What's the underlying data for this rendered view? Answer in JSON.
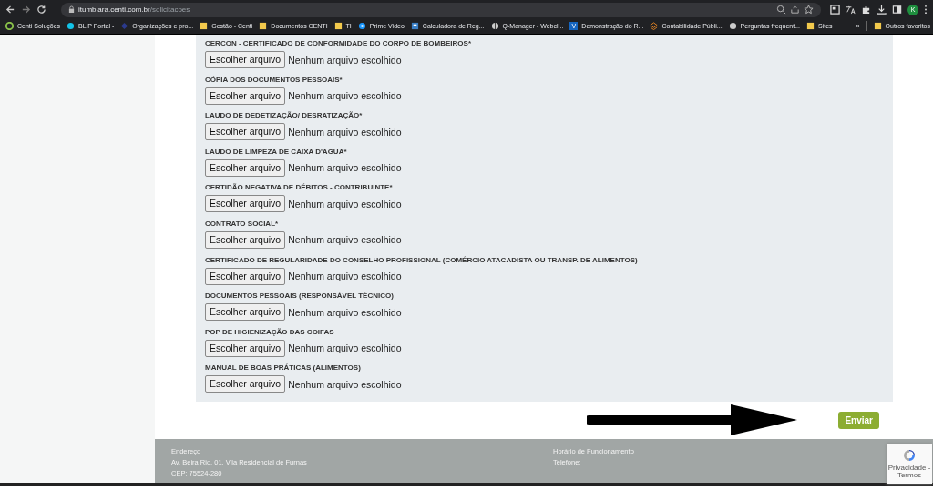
{
  "browser": {
    "url_host": "itumbiara.centi.com.br",
    "url_path": "/solicitacoes",
    "profile_initial": "K",
    "bookmarks": [
      {
        "label": "Centi Soluções",
        "kind": "logo"
      },
      {
        "label": "BLiP Portal -",
        "kind": "drop"
      },
      {
        "label": "Organizações e pro...",
        "kind": "diamond"
      },
      {
        "label": "Gestão - Centi",
        "kind": "folder"
      },
      {
        "label": "Documentos CENTI",
        "kind": "folder"
      },
      {
        "label": "TI",
        "kind": "folder"
      },
      {
        "label": "Prime Video",
        "kind": "circle"
      },
      {
        "label": "Calculadora de Reg...",
        "kind": "square"
      },
      {
        "label": "Q-Manager - Webcl...",
        "kind": "globe"
      },
      {
        "label": "Demonstração do R...",
        "kind": "letter",
        "glyph": "V"
      },
      {
        "label": "Contabilidade Públi...",
        "kind": "layers"
      },
      {
        "label": "Perguntas frequent...",
        "kind": "globe"
      },
      {
        "label": "Sites",
        "kind": "folder"
      }
    ],
    "overflow": "»",
    "other_bookmarks": "Outros favoritos"
  },
  "form": {
    "fields": [
      {
        "label": "CERCON - CERTIFICADO DE CONFORMIDADE DO CORPO DE BOMBEIROS*",
        "button": "Escolher arquivo",
        "status": "Nenhum arquivo escolhido"
      },
      {
        "label": "CÓPIA DOS DOCUMENTOS PESSOAIS*",
        "button": "Escolher arquivo",
        "status": "Nenhum arquivo escolhido"
      },
      {
        "label": "LAUDO DE DEDETIZAÇÃO/ DESRATIZAÇÃO*",
        "button": "Escolher arquivo",
        "status": "Nenhum arquivo escolhido"
      },
      {
        "label": "LAUDO DE LIMPEZA DE CAIXA D'AGUA*",
        "button": "Escolher arquivo",
        "status": "Nenhum arquivo escolhido"
      },
      {
        "label": "CERTIDÃO NEGATIVA DE DÉBITOS - CONTRIBUINTE*",
        "button": "Escolher arquivo",
        "status": "Nenhum arquivo escolhido"
      },
      {
        "label": "CONTRATO SOCIAL*",
        "button": "Escolher arquivo",
        "status": "Nenhum arquivo escolhido"
      },
      {
        "label": "CERTIFICADO DE REGULARIDADE DO CONSELHO PROFISSIONAL (COMÉRCIO ATACADISTA OU TRANSP. DE ALIMENTOS)",
        "button": "Escolher arquivo",
        "status": "Nenhum arquivo escolhido"
      },
      {
        "label": "DOCUMENTOS PESSOAIS (RESPONSÁVEL TÉCNICO)",
        "button": "Escolher arquivo",
        "status": "Nenhum arquivo escolhido"
      },
      {
        "label": "POP DE HIGIENIZAÇÃO DAS COIFAS",
        "button": "Escolher arquivo",
        "status": "Nenhum arquivo escolhido"
      },
      {
        "label": "MANUAL DE BOAS PRÁTICAS (ALIMENTOS)",
        "button": "Escolher arquivo",
        "status": "Nenhum arquivo escolhido"
      }
    ],
    "submit": "Enviar"
  },
  "footer": {
    "address_heading": "Endereço",
    "address_line": "Av. Beira Rio, 01, Vila Residencial de Furnas",
    "cep": "CEP: 75524-280",
    "hours_heading": "Horário de Funcionamento",
    "phone": "Telefone:",
    "recaptcha_links": "Privacidade - Termos"
  }
}
